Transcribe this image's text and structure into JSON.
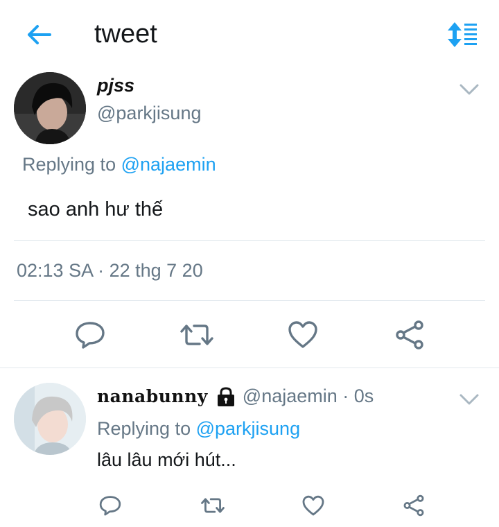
{
  "header": {
    "title": "tweet",
    "back_icon": "arrow-left-icon",
    "sort_icon": "sort-icon"
  },
  "colors": {
    "accent": "#1da1f2",
    "muted": "#657786",
    "text": "#14171a",
    "divider": "#e1e8ed"
  },
  "main_tweet": {
    "display_name": "pjss",
    "handle": "@parkjisung",
    "replying_prefix": "Replying to",
    "replying_to": "@najaemin",
    "text": "sao anh hư thế",
    "meta": "02:13 SA · 22 thg 7 20",
    "actions": [
      "reply-icon",
      "retweet-icon",
      "like-icon",
      "share-icon"
    ]
  },
  "reply_tweet": {
    "display_name": "nanabunny",
    "handle_time": "@najaemin · 0s",
    "replying_prefix": "Replying to",
    "replying_to": "@parkjisung",
    "text": "lâu lâu mới hút...",
    "actions": [
      "reply-icon",
      "retweet-icon",
      "like-icon",
      "share-icon"
    ]
  }
}
